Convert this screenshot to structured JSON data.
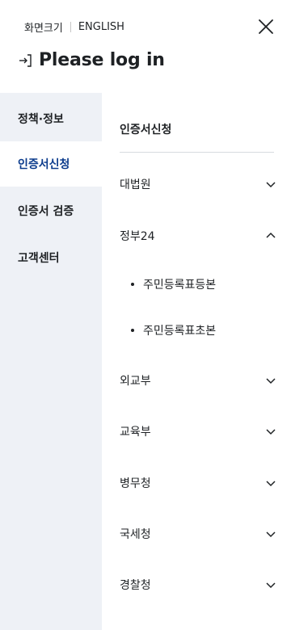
{
  "header": {
    "font_size_label": "화면크기",
    "language_label": "ENGLISH",
    "login_label": "Please log in"
  },
  "sidebar": {
    "items": [
      {
        "label": "정책·정보",
        "active": false
      },
      {
        "label": "인증서신청",
        "active": true
      },
      {
        "label": "인증서 검증",
        "active": false
      },
      {
        "label": "고객센터",
        "active": false
      }
    ]
  },
  "main": {
    "section_title": "인증서신청",
    "menu": [
      {
        "label": "대법원",
        "expanded": false
      },
      {
        "label": "정부24",
        "expanded": true,
        "children": [
          "주민등록표등본",
          "주민등록표초본"
        ]
      },
      {
        "label": "외교부",
        "expanded": false
      },
      {
        "label": "교육부",
        "expanded": false
      },
      {
        "label": "병무청",
        "expanded": false
      },
      {
        "label": "국세청",
        "expanded": false
      },
      {
        "label": "경찰청",
        "expanded": false
      }
    ]
  },
  "colors": {
    "active_text": "#0b3b8c",
    "sidebar_bg": "#eef1f6",
    "text": "#1e2124"
  },
  "icons": {
    "close": "close-icon",
    "login": "login-icon",
    "collapsed": "chevron-down-icon",
    "expanded": "chevron-up-icon"
  }
}
